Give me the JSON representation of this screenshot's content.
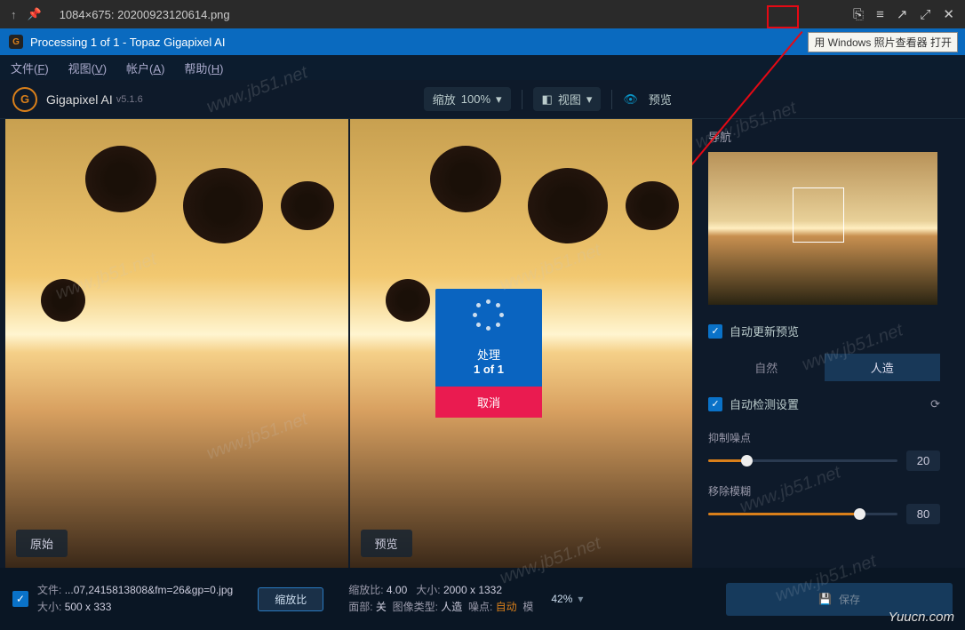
{
  "outer": {
    "title": "1084×675: 20200923120614.png",
    "tooltip": "用 Windows 照片查看器 打开"
  },
  "app": {
    "title": "Processing 1 of 1 - Topaz Gigapixel AI",
    "name": "Gigapixel AI",
    "version": "v5.1.6"
  },
  "menu": {
    "file": "文件",
    "file_a": "F",
    "view": "视图",
    "view_a": "V",
    "account": "帐户",
    "account_a": "A",
    "help": "帮助",
    "help_a": "H"
  },
  "toolbar": {
    "zoom_label": "缩放",
    "zoom_value": "100%",
    "view_label": "视图",
    "preview_label": "预览"
  },
  "preview": {
    "original_label": "原始",
    "preview_label": "预览"
  },
  "progress": {
    "title": "处理",
    "count": "1 of 1",
    "cancel": "取消"
  },
  "side": {
    "nav_title": "导航",
    "auto_update": "自动更新预览",
    "tab_natural": "自然",
    "tab_artificial": "人造",
    "auto_detect": "自动检测设置",
    "suppress_noise": "抑制噪点",
    "suppress_noise_val": "20",
    "remove_blur": "移除模糊",
    "remove_blur_val": "80"
  },
  "bottom": {
    "file_label": "文件:",
    "file_value": "...07,2415813808&fm=26&gp=0.jpg",
    "size_label": "大小:",
    "size_value": "500 x 333",
    "scale_btn": "缩放比",
    "ratio_label": "缩放比:",
    "ratio_value": "4.00",
    "newsize_label": "大小:",
    "newsize_value": "2000 x 1332",
    "face_label": "面部:",
    "face_value": "关",
    "type_label": "图像类型:",
    "type_value": "人造",
    "noise_label": "噪点:",
    "noise_value": "自动",
    "blur_label": "模",
    "percent": "42%",
    "save": "保存"
  },
  "watermarks": {
    "jb51": "www.jb51.net",
    "yuucn": "Yuucn.com"
  }
}
